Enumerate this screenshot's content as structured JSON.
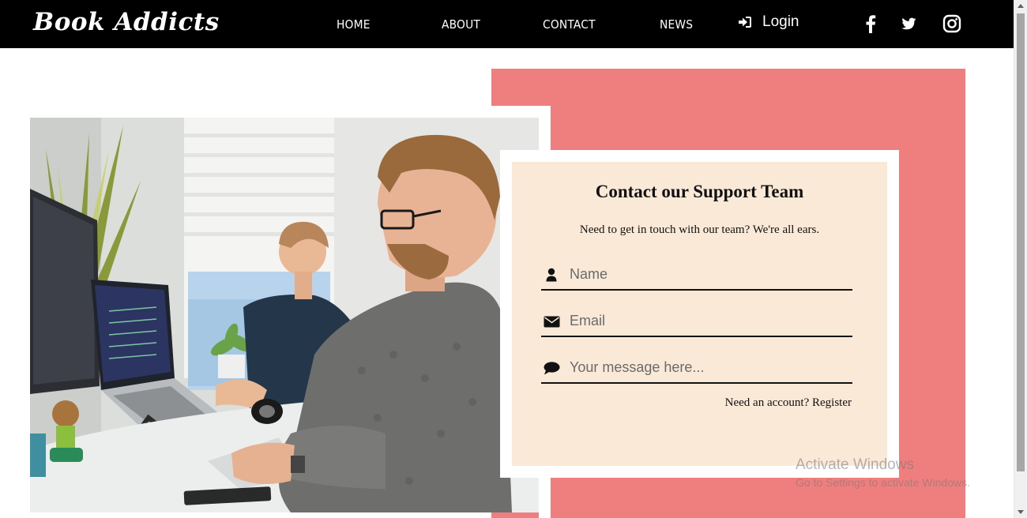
{
  "brand": {
    "logo": "Book Addicts"
  },
  "nav": {
    "home": "HOME",
    "about": "ABOUT",
    "contact": "CONTACT",
    "news": "NEWS",
    "login": "Login",
    "icons": [
      "facebook-icon",
      "twitter-icon",
      "instagram-icon"
    ]
  },
  "contact_form": {
    "title": "Contact our Support Team",
    "subtitle": "Need to get in touch with our team? We're all ears.",
    "name_placeholder": "Name",
    "email_placeholder": "Email",
    "message_placeholder": "Your message here...",
    "register_prompt": "Need an account?",
    "register_link": "Register"
  },
  "watermark": {
    "title": "Activate Windows",
    "subtitle": "Go to Settings to activate Windows."
  },
  "colors": {
    "navbar": "#000000",
    "accent_pink": "#ef7f7e",
    "form_background": "#fae9d7"
  }
}
